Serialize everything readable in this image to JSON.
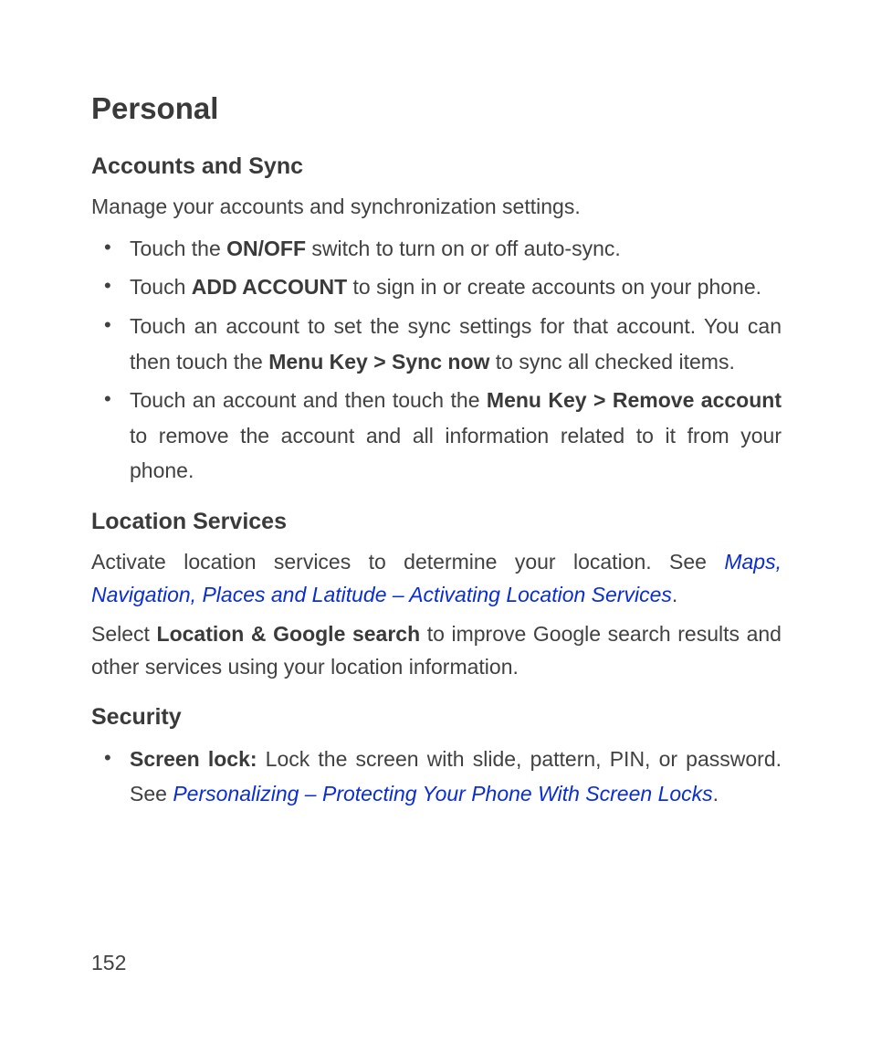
{
  "page": {
    "number": "152",
    "heading": "Personal",
    "sections": {
      "accounts": {
        "title": "Accounts and Sync",
        "intro": "Manage your accounts and synchronization settings.",
        "items": [
          {
            "pre": "Touch the ",
            "bold1": "ON/OFF",
            "post": " switch to turn on or off auto-sync."
          },
          {
            "pre": "Touch ",
            "bold1": "ADD ACCOUNT",
            "post": " to sign in or create accounts on your phone."
          },
          {
            "pre": "Touch an account to set the sync settings for that account. You can then touch the ",
            "bold1": "Menu Key > Sync now",
            "post": " to sync all checked items."
          },
          {
            "pre": "Touch an account and then touch the ",
            "bold1": "Menu Key > Remove account",
            "post": " to remove the account and all information related to it from your phone."
          }
        ]
      },
      "location": {
        "title": "Location Services",
        "para1_pre": "Activate location services to determine your location. See ",
        "para1_link": "Maps, Navigation, Places and Latitude – Activating Location Services",
        "para1_post": ".",
        "para2_pre": "Select ",
        "para2_bold": "Location & Google search",
        "para2_post": " to improve Google search results and other services using your location information."
      },
      "security": {
        "title": "Security",
        "items": [
          {
            "bold": "Screen lock:",
            "mid": " Lock the screen with slide, pattern, PIN, or password. See ",
            "link": "Personalizing – Protecting Your Phone With Screen Locks",
            "post": "."
          }
        ]
      }
    }
  }
}
